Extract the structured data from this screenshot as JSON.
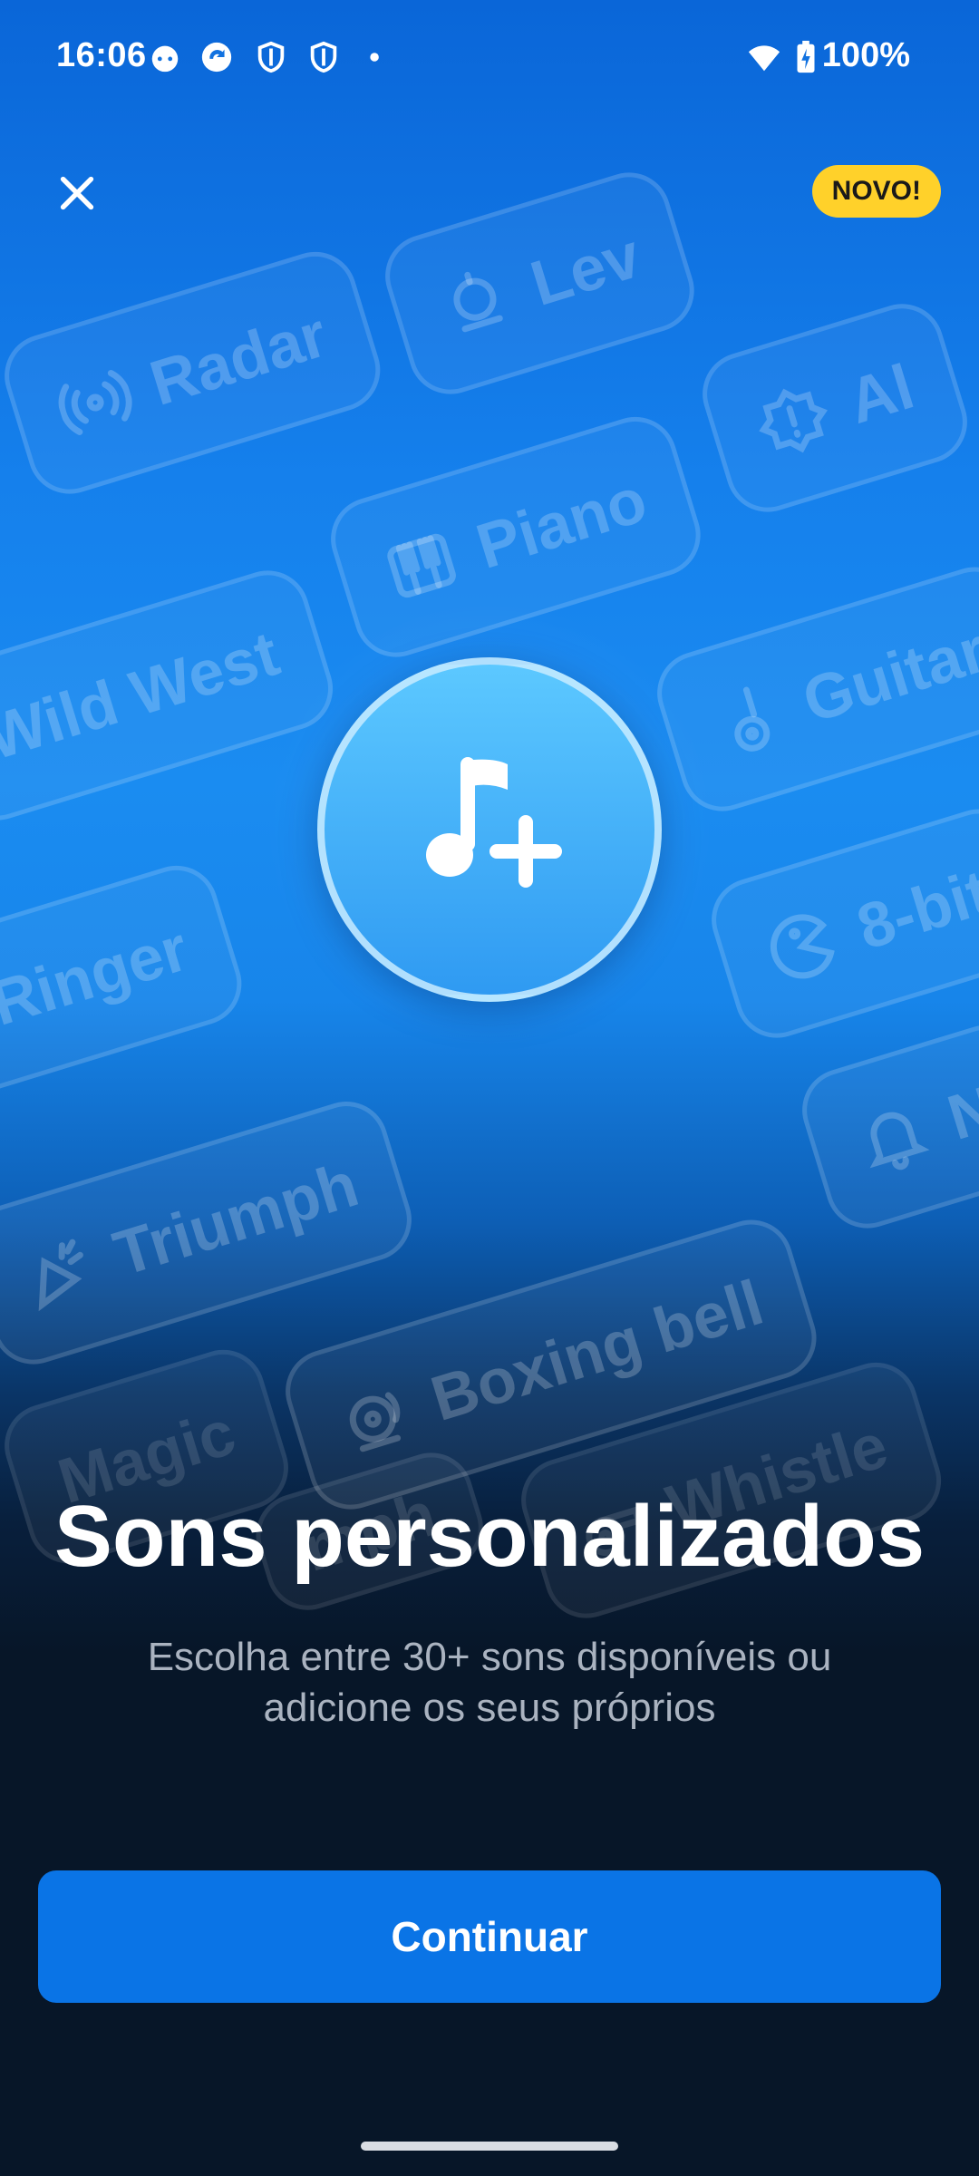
{
  "status_bar": {
    "time": "16:06",
    "battery_text": "100%",
    "icons": [
      "cat-face-icon",
      "sync-app-icon",
      "shield-icon",
      "shield-icon",
      "dot-icon",
      "wifi-icon",
      "battery-charging-icon"
    ]
  },
  "header": {
    "close_icon": "close-icon",
    "badge": "NOVO!"
  },
  "background_chips": [
    {
      "label": "Radar",
      "icon": "radar-icon"
    },
    {
      "label": "Lev",
      "icon": "bell-icon"
    },
    {
      "label": "Al",
      "icon": "alert-badge-icon"
    },
    {
      "label": "Piano",
      "icon": "piano-icon"
    },
    {
      "label": "Wild West",
      "icon": ""
    },
    {
      "label": "Guitar",
      "icon": "guitar-icon"
    },
    {
      "label": "e Ringer",
      "icon": ""
    },
    {
      "label": "8-bit",
      "icon": "pacman-icon"
    },
    {
      "label": "Triumph",
      "icon": "party-horn-icon"
    },
    {
      "label": "N",
      "icon": "bell-icon"
    },
    {
      "label": "Boxing bell",
      "icon": "boxing-bell-icon"
    },
    {
      "label": "Magic",
      "icon": ""
    },
    {
      "label": "Whistle",
      "icon": "whistle-icon"
    },
    {
      "label": "mph",
      "icon": ""
    }
  ],
  "hero": {
    "icon": "music-note-add-icon"
  },
  "content": {
    "title": "Sons personalizados",
    "subtitle": "Escolha entre 30+ sons disponíveis ou adicione os seus próprios"
  },
  "actions": {
    "continue_label": "Continuar"
  },
  "colors": {
    "primary_button": "#0a74e6",
    "badge": "#ffd12a",
    "background_bottom": "#071628",
    "background_top": "#0a66d8"
  }
}
